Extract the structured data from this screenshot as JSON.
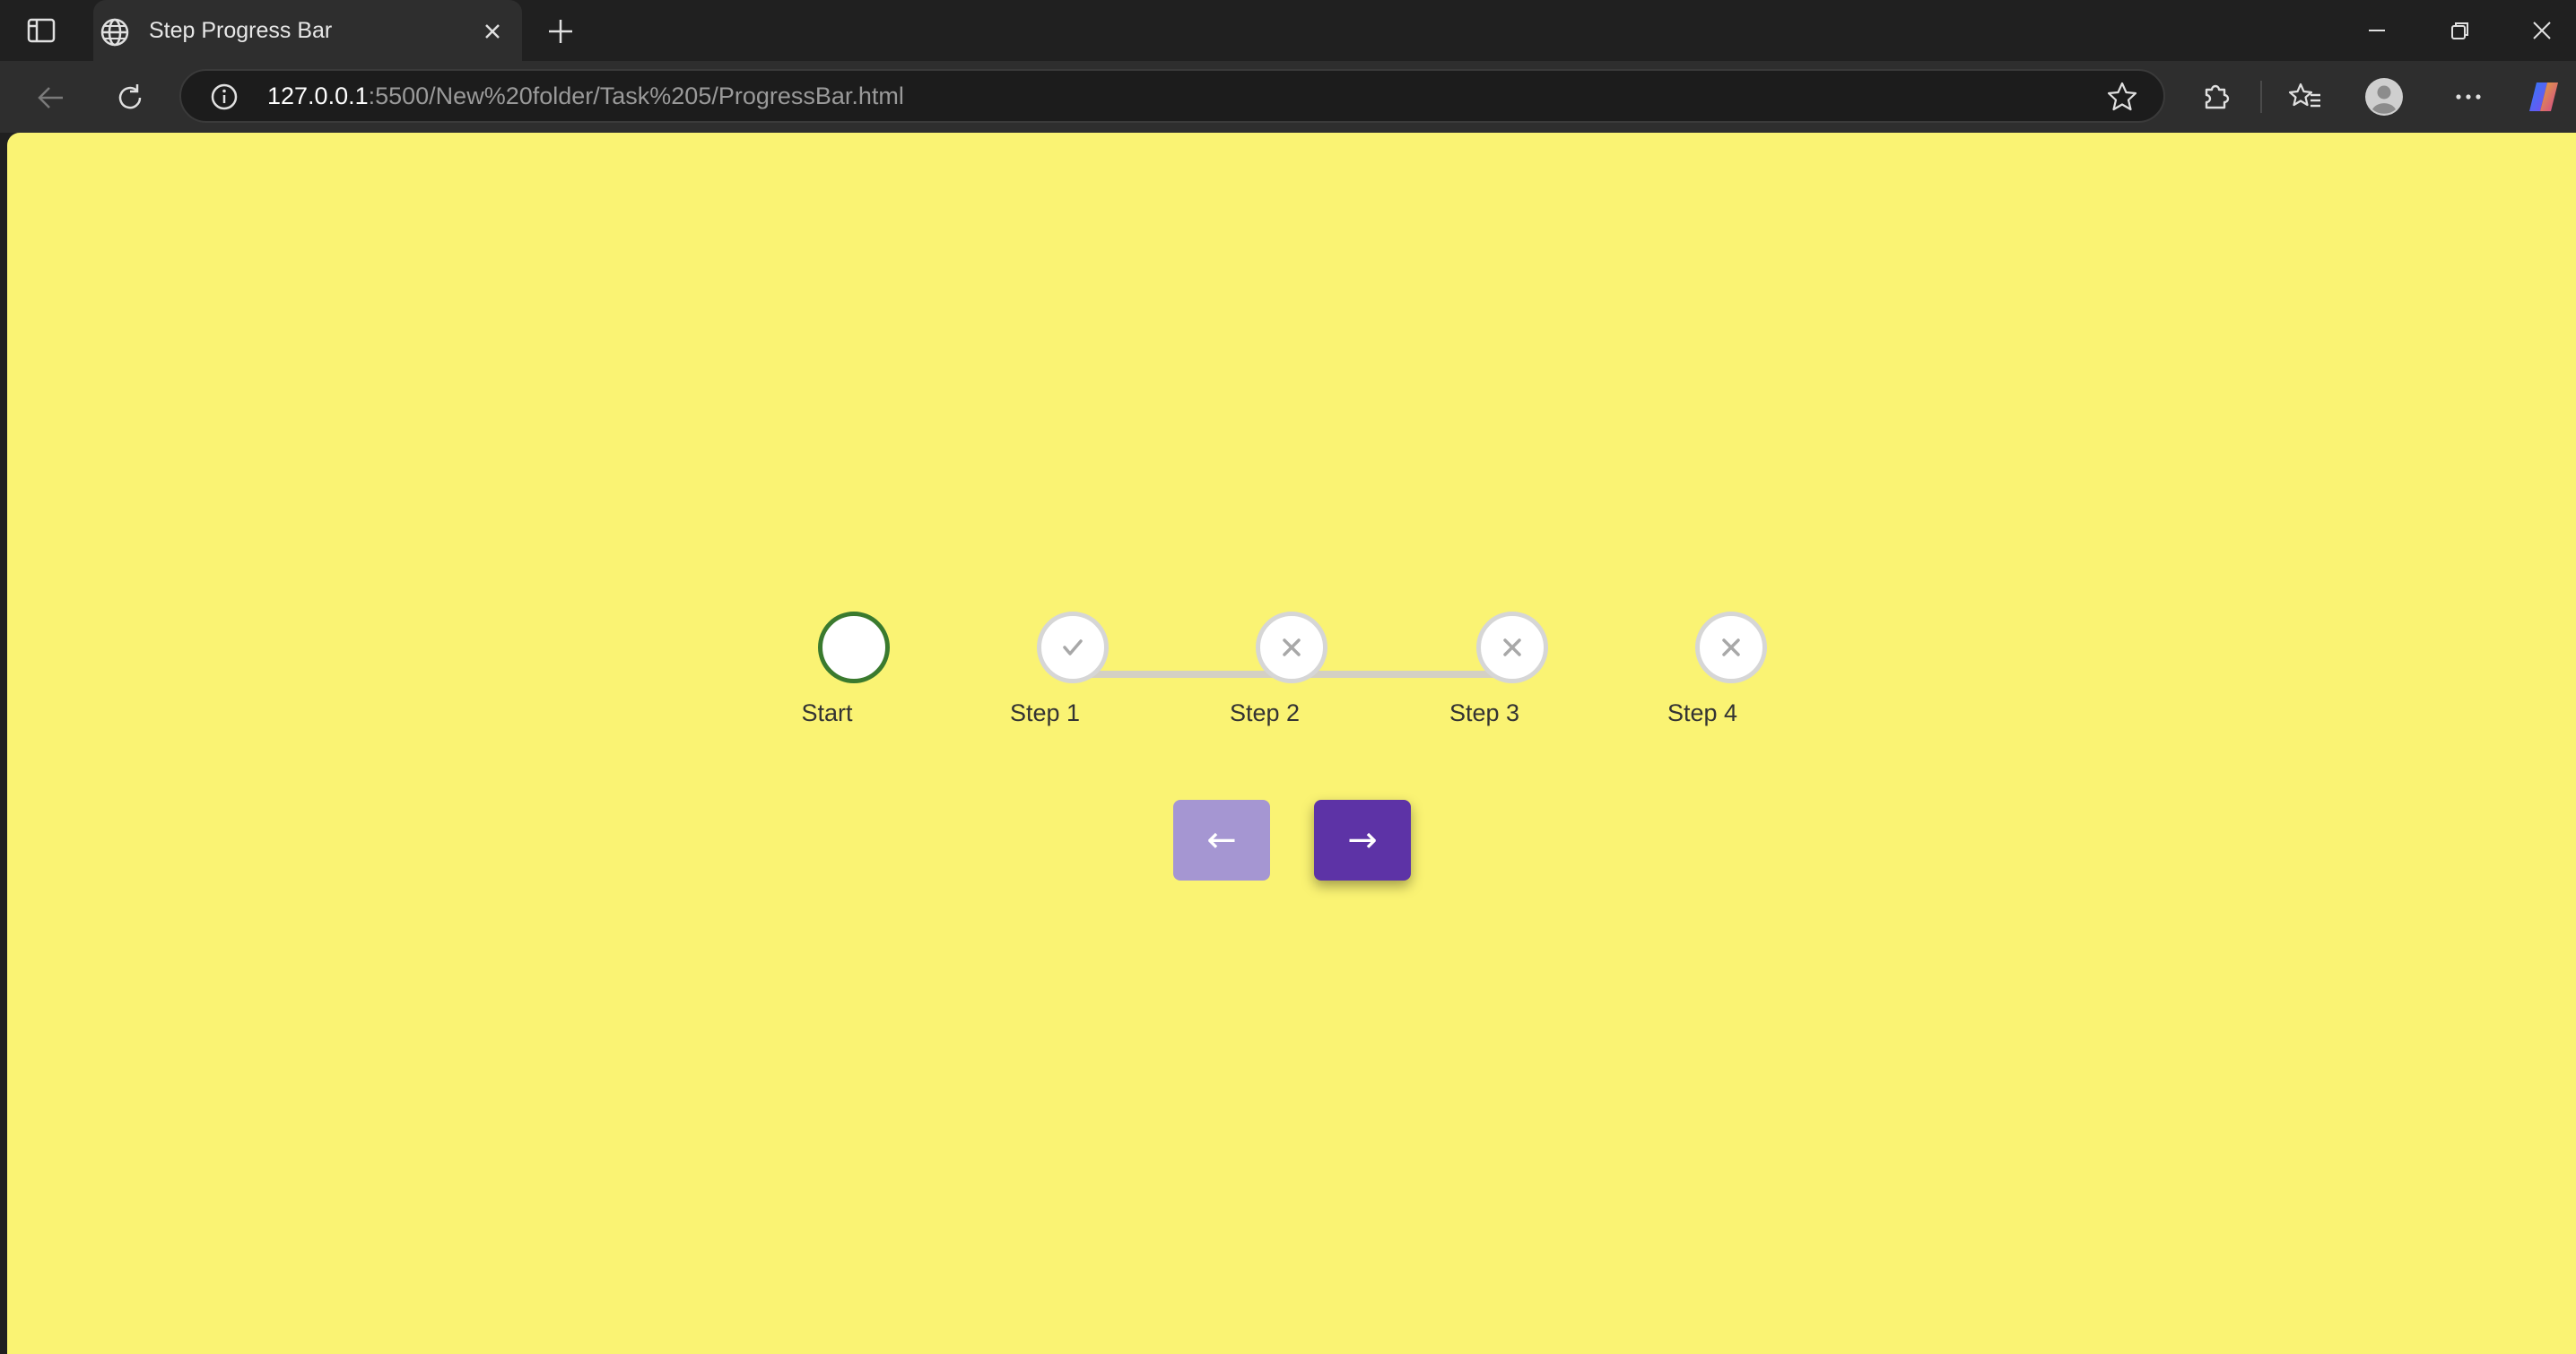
{
  "browser": {
    "tab_title": "Step Progress Bar",
    "url_host": "127.0.0.1",
    "url_rest": ":5500/New%20folder/Task%205/ProgressBar.html",
    "icons": [
      "sidebar-icon",
      "globe-icon",
      "close-icon",
      "plus-icon",
      "minimize-icon",
      "restore-icon",
      "back-icon",
      "reload-icon",
      "info-icon",
      "star-icon",
      "extensions-icon",
      "favorites-icon",
      "profile-icon",
      "more-icon",
      "copilot-icon"
    ]
  },
  "page": {
    "background": "#faf373",
    "steps": [
      {
        "label": "Start",
        "state": "active",
        "icon": "none"
      },
      {
        "label": "Step 1",
        "state": "completed",
        "icon": "check-icon"
      },
      {
        "label": "Step 2",
        "state": "incomplete",
        "icon": "x-icon"
      },
      {
        "label": "Step 3",
        "state": "incomplete",
        "icon": "x-icon"
      },
      {
        "label": "Step 4",
        "state": "incomplete",
        "icon": "x-icon"
      }
    ],
    "buttons": {
      "prev_label": "←",
      "next_label": "→"
    },
    "colors": {
      "active_border": "#3a7a2e",
      "prev_button": "#a596d2",
      "next_button": "#5d33a6"
    }
  }
}
